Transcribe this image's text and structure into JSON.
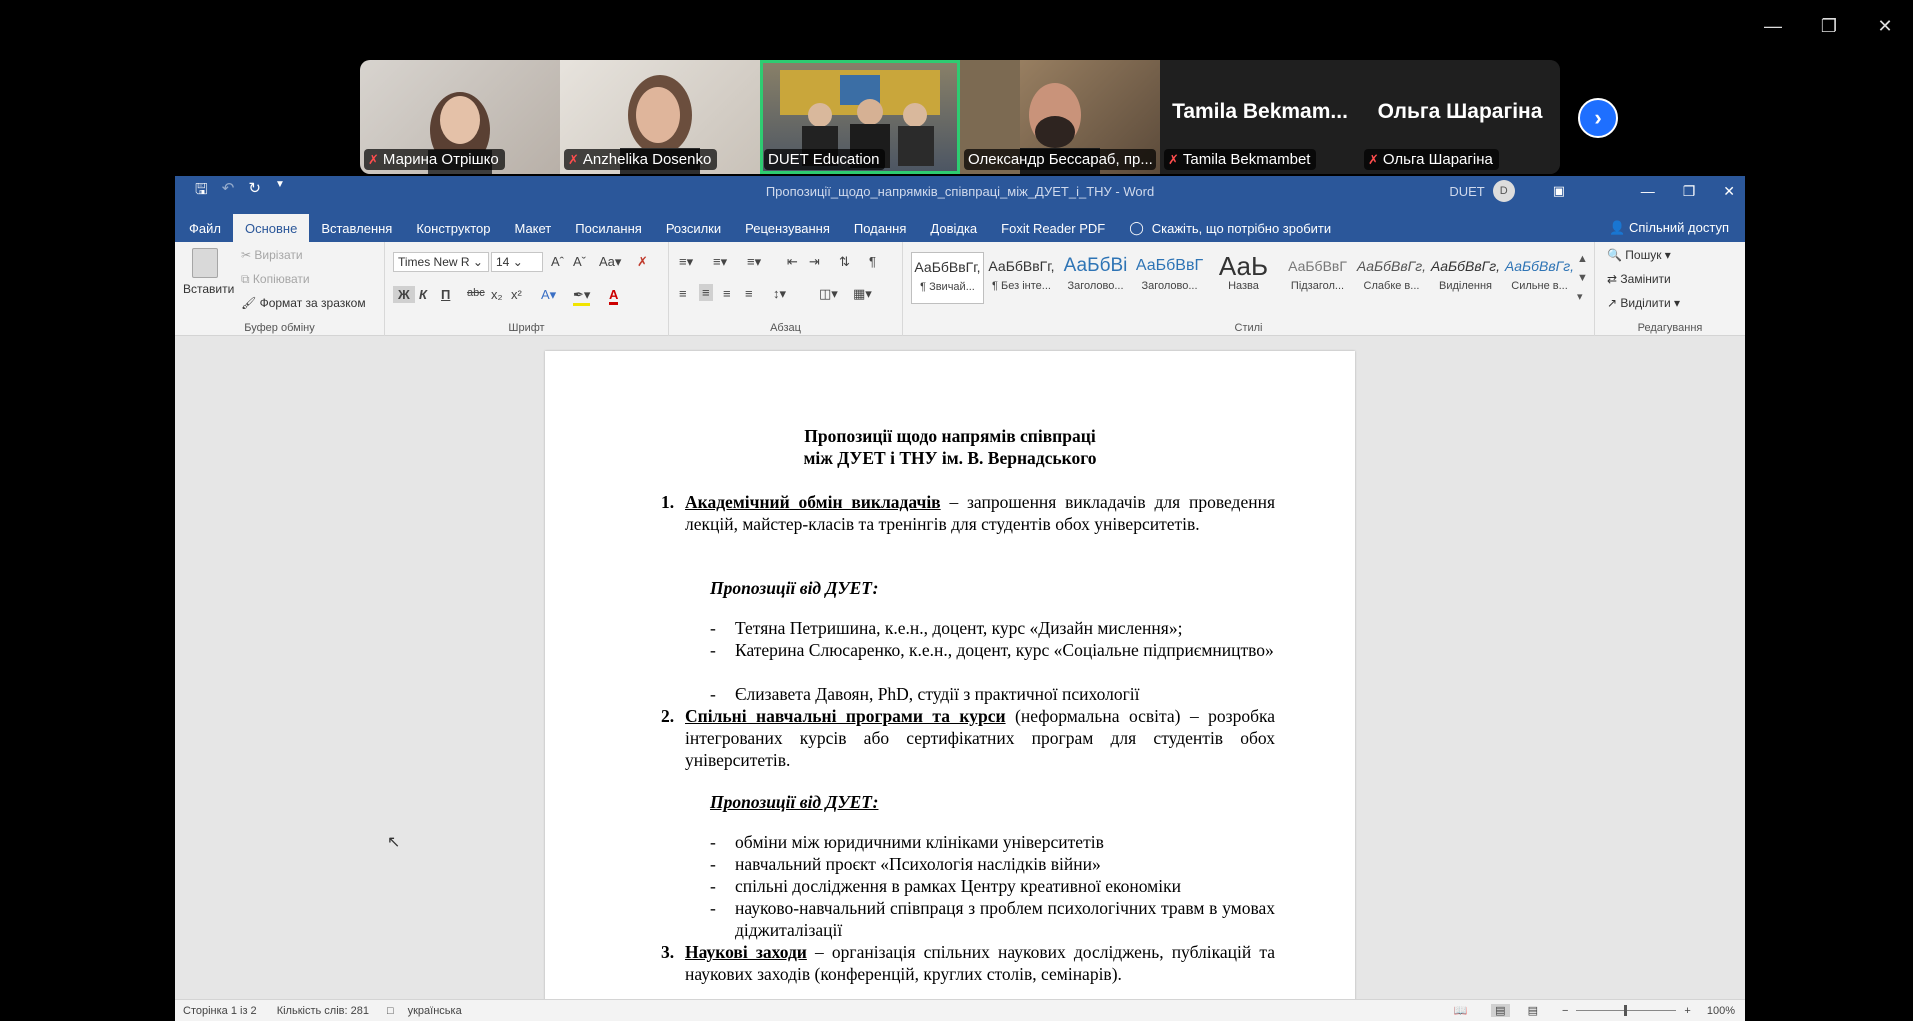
{
  "participants": [
    {
      "name": "Марина Отрішко",
      "muted": true,
      "video": true
    },
    {
      "name": "Anzhelika Dosenko",
      "muted": true,
      "video": true
    },
    {
      "name": "DUET Education",
      "muted": false,
      "video": true,
      "active": true
    },
    {
      "name": "Олександр Бессараб,  пр...",
      "muted": false,
      "video": true
    },
    {
      "name": "Tamila Bekmambet",
      "big": "Tamila  Bekmam...",
      "muted": true,
      "video": false
    },
    {
      "name": "Ольга Шарагіна",
      "big": "Ольга Шарагіна",
      "muted": true,
      "video": false
    }
  ],
  "word": {
    "doc_title": "Пропозиції_щодо_напрямків_співпраці_між_ДУЕТ_і_ТНУ  -  Word",
    "account": "DUET",
    "account_initial": "D",
    "tabs": [
      "Файл",
      "Основне",
      "Вставлення",
      "Конструктор",
      "Макет",
      "Посилання",
      "Розсилки",
      "Рецензування",
      "Подання",
      "Довідка",
      "Foxit Reader PDF"
    ],
    "tell_me": "Скажіть, що потрібно зробити",
    "share": "Спільний доступ",
    "clipboard": {
      "paste": "Вставити",
      "cut": "Вирізати",
      "copy": "Копіювати",
      "format_painter": "Формат за зразком",
      "label": "Буфер обміну"
    },
    "font": {
      "name": "Times New R",
      "size": "14",
      "label": "Шрифт"
    },
    "paragraph_label": "Абзац",
    "styles": [
      {
        "preview": "АаБбВвГг,",
        "name": "¶ Звичай..."
      },
      {
        "preview": "АаБбВвГг,",
        "name": "¶ Без інте..."
      },
      {
        "preview": "АаБбВі",
        "name": "Заголово..."
      },
      {
        "preview": "АаБбВвГ",
        "name": "Заголово..."
      },
      {
        "preview": "АаЬ",
        "name": "Назва"
      },
      {
        "preview": "АаБбВвГ",
        "name": "Підзагол..."
      },
      {
        "preview": "АаБбВвГг,",
        "name": "Слабке в..."
      },
      {
        "preview": "АаБбВвГг,",
        "name": "Виділення"
      },
      {
        "preview": "АаБбВвГг,",
        "name": "Сильне в..."
      }
    ],
    "styles_label": "Стилі",
    "editing": {
      "find": "Пошук",
      "replace": "Замінити",
      "select": "Виділити",
      "label": "Редагування"
    },
    "status": {
      "page": "Сторінка 1 із 2",
      "words": "Кількість слів: 281",
      "lang": "українська",
      "zoom": "100%"
    }
  },
  "document": {
    "title_line1": "Пропозиції щодо напрямів співпраці",
    "title_line2": "між ДУЕТ і ТНУ ім. В. Вернадського",
    "item1_num": "1.",
    "item1_bold": "Академічний обмін викладачів",
    "item1_text": " – запрошення викладачів для проведення лекцій, майстер-класів та тренінгів для студентів обох університетів.",
    "proposals1": "Пропозиції від ДУЕТ:",
    "bullets1": [
      "Тетяна Петришина, к.е.н., доцент, курс «Дизайн мислення»;",
      "Катерина Слюсаренко, к.е.н., доцент, курс «Соціальне підприємництво»",
      "Єлизавета Давоян, PhD, студії з практичної психології"
    ],
    "item2_num": "2.",
    "item2_bold": "Спільні навчальні програми та курси",
    "item2_text": " (неформальна освіта) – розробка інтегрованих курсів або сертифікатних програм для студентів обох університетів.",
    "proposals2": "Пропозиції від ДУЕТ:",
    "bullets2": [
      "обміни між юридичними клініками університетів",
      "навчальний проєкт «Психологія наслідків війни»",
      "спільні дослідження в рамках Центру креативної економіки",
      "науково-навчальний співпраця з проблем психологічних травм в умовах діджиталізації"
    ],
    "item3_num": "3.",
    "item3_bold": "Наукові заходи",
    "item3_text": " – організація спільних наукових досліджень, публікацій та наукових заходів (конференцій, круглих столів, семінарів)."
  }
}
